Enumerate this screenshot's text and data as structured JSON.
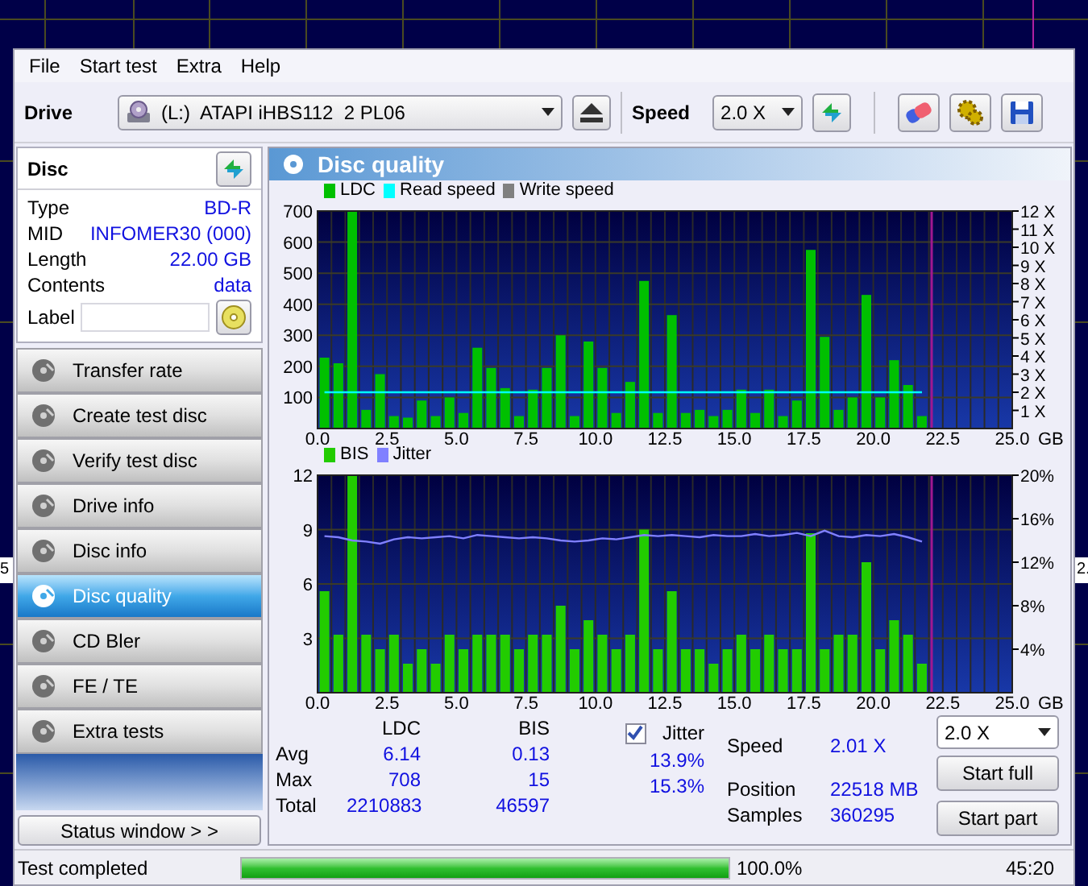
{
  "background_fragments": [
    "5",
    "2."
  ],
  "menu": [
    "File",
    "Start test",
    "Extra",
    "Help"
  ],
  "toolbar": {
    "drive_label": "Drive",
    "drive": "(L:)  ATAPI iHBS112  2 PL06",
    "speed_label": "Speed",
    "speed": "2.0 X"
  },
  "disc": {
    "title": "Disc",
    "fields": [
      {
        "label": "Type",
        "value": "BD-R"
      },
      {
        "label": "MID",
        "value": "INFOMER30 (000)"
      },
      {
        "label": "Length",
        "value": "22.00 GB"
      },
      {
        "label": "Contents",
        "value": "data"
      }
    ],
    "label_field": "Label"
  },
  "nav": [
    {
      "label": "Transfer rate",
      "selected": false
    },
    {
      "label": "Create test disc",
      "selected": false
    },
    {
      "label": "Verify test disc",
      "selected": false
    },
    {
      "label": "Drive info",
      "selected": false
    },
    {
      "label": "Disc info",
      "selected": false
    },
    {
      "label": "Disc quality",
      "selected": true
    },
    {
      "label": "CD Bler",
      "selected": false
    },
    {
      "label": "FE / TE",
      "selected": false
    },
    {
      "label": "Extra tests",
      "selected": false
    }
  ],
  "status_window_button": "Status window > >",
  "panel": {
    "title": "Disc quality",
    "charts": [
      {
        "chart_data": {
          "type": "bar",
          "xlabel": "GB",
          "grid": true,
          "xlim": [
            0,
            25
          ],
          "ylim": [
            0,
            700
          ],
          "y2lim": [
            0,
            12
          ],
          "x": [
            0.25,
            0.75,
            1.25,
            1.75,
            2.25,
            2.75,
            3.25,
            3.75,
            4.25,
            4.75,
            5.25,
            5.75,
            6.25,
            6.75,
            7.25,
            7.75,
            8.25,
            8.75,
            9.25,
            9.75,
            10.25,
            10.75,
            11.25,
            11.75,
            12.25,
            12.75,
            13.25,
            13.75,
            14.25,
            14.75,
            15.25,
            15.75,
            16.25,
            16.75,
            17.25,
            17.75,
            18.25,
            18.75,
            19.25,
            19.75,
            20.25,
            20.75,
            21.25,
            21.75
          ],
          "xticks": [
            {
              "value": 0,
              "label": "0.0"
            },
            {
              "value": 2.5,
              "label": "2.5"
            },
            {
              "value": 5,
              "label": "5.0"
            },
            {
              "value": 7.5,
              "label": "7.5"
            },
            {
              "value": 10,
              "label": "10.0"
            },
            {
              "value": 12.5,
              "label": "12.5"
            },
            {
              "value": 15,
              "label": "15.0"
            },
            {
              "value": 17.5,
              "label": "17.5"
            },
            {
              "value": 20,
              "label": "20.0"
            },
            {
              "value": 22.5,
              "label": "22.5"
            },
            {
              "value": 25,
              "label": "25.0"
            }
          ],
          "yticks": [
            100,
            200,
            300,
            400,
            500,
            600,
            700
          ],
          "y2ticks": [
            {
              "value": 1,
              "label": "1 X"
            },
            {
              "value": 2,
              "label": "2 X"
            },
            {
              "value": 3,
              "label": "3 X"
            },
            {
              "value": 4,
              "label": "4 X"
            },
            {
              "value": 5,
              "label": "5 X"
            },
            {
              "value": 6,
              "label": "6 X"
            },
            {
              "value": 7,
              "label": "7 X"
            },
            {
              "value": 8,
              "label": "8 X"
            },
            {
              "value": 9,
              "label": "9 X"
            },
            {
              "value": 10,
              "label": "10 X"
            },
            {
              "value": 11,
              "label": "11 X"
            },
            {
              "value": 12,
              "label": "12 X"
            }
          ],
          "series": [
            {
              "name": "LDC",
              "color": "#00c000",
              "values": [
                228,
                210,
                700,
                60,
                175,
                40,
                35,
                90,
                40,
                100,
                50,
                260,
                195,
                130,
                40,
                125,
                195,
                300,
                40,
                280,
                195,
                50,
                150,
                475,
                50,
                365,
                50,
                60,
                40,
                60,
                125,
                50,
                125,
                40,
                90,
                575,
                295,
                60,
                100,
                430,
                100,
                220,
                140,
                40
              ]
            },
            {
              "name": "Read speed",
              "color": "#00ffff",
              "type": "line",
              "axis": "y2",
              "values": [
                2,
                2,
                2,
                2,
                2,
                2,
                2,
                2,
                2,
                2,
                2,
                2,
                2,
                2,
                2,
                2,
                2,
                2,
                2,
                2,
                2,
                2,
                2,
                2,
                2,
                2,
                2,
                2,
                2,
                2,
                2,
                2,
                2,
                2,
                2,
                2,
                2,
                2,
                2,
                2,
                2,
                2,
                2,
                2
              ]
            },
            {
              "name": "Write speed",
              "color": "#808080",
              "type": "line",
              "axis": "y2",
              "values": [
                null,
                null,
                null,
                null,
                null,
                null,
                null,
                null,
                null,
                null,
                null,
                null,
                null,
                null,
                null,
                null,
                null,
                null,
                null,
                null,
                null,
                null,
                null,
                null,
                null,
                null,
                null,
                null,
                null,
                null,
                null,
                null,
                null,
                null,
                null,
                null,
                null,
                null,
                null,
                null,
                null,
                null,
                null,
                null
              ]
            }
          ],
          "ref_lines": [
            {
              "axis": "x",
              "value": 22.1
            }
          ]
        }
      },
      {
        "chart_data": {
          "type": "bar",
          "xlabel": "GB",
          "grid": true,
          "xlim": [
            0,
            25
          ],
          "ylim": [
            0,
            12
          ],
          "y2lim": [
            0,
            20
          ],
          "x": [
            0.25,
            0.75,
            1.25,
            1.75,
            2.25,
            2.75,
            3.25,
            3.75,
            4.25,
            4.75,
            5.25,
            5.75,
            6.25,
            6.75,
            7.25,
            7.75,
            8.25,
            8.75,
            9.25,
            9.75,
            10.25,
            10.75,
            11.25,
            11.75,
            12.25,
            12.75,
            13.25,
            13.75,
            14.25,
            14.75,
            15.25,
            15.75,
            16.25,
            16.75,
            17.25,
            17.75,
            18.25,
            18.75,
            19.25,
            19.75,
            20.25,
            20.75,
            21.25,
            21.75
          ],
          "xticks": [
            {
              "value": 0,
              "label": "0.0"
            },
            {
              "value": 2.5,
              "label": "2.5"
            },
            {
              "value": 5,
              "label": "5.0"
            },
            {
              "value": 7.5,
              "label": "7.5"
            },
            {
              "value": 10,
              "label": "10.0"
            },
            {
              "value": 12.5,
              "label": "12.5"
            },
            {
              "value": 15,
              "label": "15.0"
            },
            {
              "value": 17.5,
              "label": "17.5"
            },
            {
              "value": 20,
              "label": "20.0"
            },
            {
              "value": 22.5,
              "label": "22.5"
            },
            {
              "value": 25,
              "label": "25.0"
            }
          ],
          "yticks": [
            3,
            6,
            9,
            12
          ],
          "y2ticks": [
            {
              "value": 4,
              "label": "4%"
            },
            {
              "value": 8,
              "label": "8%"
            },
            {
              "value": 12,
              "label": "12%"
            },
            {
              "value": 16,
              "label": "16%"
            },
            {
              "value": 20,
              "label": "20%"
            }
          ],
          "series": [
            {
              "name": "BIS",
              "color": "#22cc00",
              "values": [
                5.6,
                3.2,
                12,
                3.2,
                2.4,
                3.2,
                1.6,
                2.4,
                1.6,
                3.2,
                2.4,
                3.2,
                3.2,
                3.2,
                2.4,
                3.2,
                3.2,
                4.8,
                2.4,
                4,
                3.2,
                2.4,
                3.2,
                9,
                2.4,
                5.6,
                2.4,
                2.4,
                1.6,
                2.4,
                3.2,
                2.4,
                3.2,
                2.4,
                2.4,
                8.8,
                2.4,
                3.2,
                3.2,
                7.2,
                2.4,
                4,
                3.2,
                1.6
              ]
            },
            {
              "name": "Jitter",
              "color": "#8080ff",
              "type": "line",
              "axis": "y2",
              "values": [
                14.4,
                14.3,
                14.0,
                13.9,
                13.7,
                14.1,
                14.3,
                14.2,
                14.3,
                14.4,
                14.2,
                14.5,
                14.4,
                14.3,
                14.2,
                14.3,
                14.2,
                14.0,
                13.9,
                14.0,
                14.2,
                14.1,
                14.3,
                14.5,
                14.4,
                14.5,
                14.4,
                14.3,
                14.5,
                14.4,
                14.4,
                14.6,
                14.4,
                14.5,
                14.7,
                14.4,
                14.9,
                14.4,
                14.3,
                14.5,
                14.4,
                14.6,
                14.3,
                13.9
              ]
            }
          ],
          "ref_lines": [
            {
              "axis": "x",
              "value": 22.1
            }
          ]
        }
      }
    ]
  },
  "stats": {
    "columns": [
      "LDC",
      "BIS"
    ],
    "rows": [
      {
        "label": "Avg",
        "ldc": "6.14",
        "bis": "0.13"
      },
      {
        "label": "Max",
        "ldc": "708",
        "bis": "15"
      },
      {
        "label": "Total",
        "ldc": "2210883",
        "bis": "46597"
      }
    ],
    "jitter": {
      "label": "Jitter",
      "checked": true,
      "values": [
        "13.9%",
        "15.3%"
      ]
    },
    "info": [
      {
        "label": "Speed",
        "value": "2.01 X"
      },
      {
        "label": "Position",
        "value": "22518 MB"
      },
      {
        "label": "Samples",
        "value": "360295"
      }
    ],
    "speed_select": "2.0 X",
    "buttons": [
      "Start full",
      "Start part"
    ]
  },
  "status_bar": {
    "message": "Test completed",
    "progress": {
      "level": 1.0
    },
    "percent": "100.0%",
    "time": "45:20"
  }
}
